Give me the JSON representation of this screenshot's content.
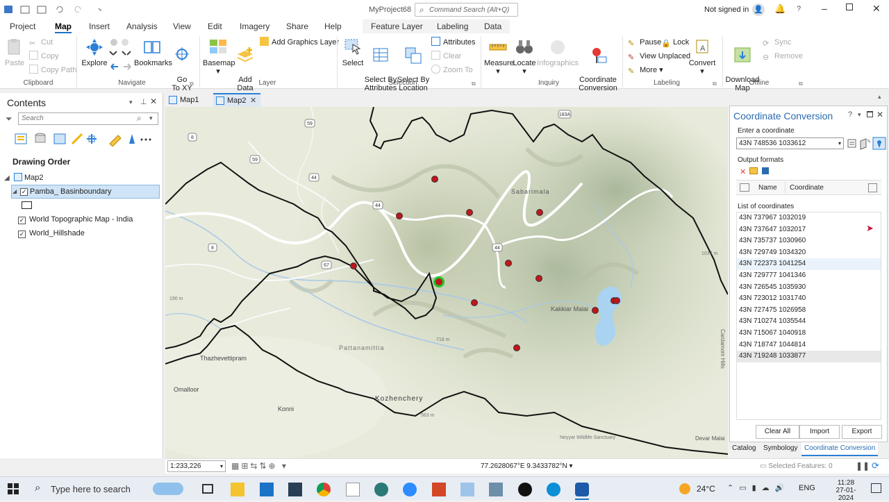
{
  "app": {
    "project_name": "MyProject68",
    "search_placeholder": "Command Search (Alt+Q)",
    "signin": "Not signed in"
  },
  "ribbon_tabs": [
    "Project",
    "Map",
    "Insert",
    "Analysis",
    "View",
    "Edit",
    "Imagery",
    "Share",
    "Help",
    "Feature Layer",
    "Labeling",
    "Data"
  ],
  "ribbon": {
    "clipboard": {
      "paste": "Paste",
      "cut": "Cut",
      "copy": "Copy",
      "copy_path": "Copy Path",
      "label": "Clipboard"
    },
    "navigate": {
      "explore": "Explore",
      "bookmarks": "Bookmarks",
      "go_to_xy": "Go\nTo XY",
      "label": "Navigate"
    },
    "layer": {
      "basemap": "Basemap",
      "add_data": "Add\nData",
      "add_graphics": "Add Graphics Layer",
      "label": "Layer"
    },
    "selection": {
      "select": "Select",
      "select_by_attributes": "Select By\nAttributes",
      "select_by_location": "Select By\nLocation",
      "attributes": "Attributes",
      "clear": "Clear",
      "zoom_to": "Zoom To",
      "label": "Selection"
    },
    "inquiry": {
      "measure": "Measure",
      "locate": "Locate",
      "infographics": "Infographics",
      "coordinate_conversion": "Coordinate\nConversion",
      "label": "Inquiry"
    },
    "labeling": {
      "pause": "Pause",
      "lock": "Lock",
      "view_unplaced": "View Unplaced",
      "more": "More",
      "convert": "Convert",
      "label": "Labeling"
    },
    "offline": {
      "download_map": "Download\nMap",
      "sync": "Sync",
      "remove": "Remove",
      "label": "Offline"
    }
  },
  "contents": {
    "title": "Contents",
    "search_placeholder": "Search",
    "drawing_order": "Drawing Order",
    "map_name": "Map2",
    "layers": [
      {
        "name": "Pamba_ Basinboundary",
        "checked": true,
        "selected": true
      },
      {
        "name": "World Topographic Map - India",
        "checked": true
      },
      {
        "name": "World_Hillshade",
        "checked": true
      }
    ]
  },
  "map_tabs": [
    {
      "name": "Map1"
    },
    {
      "name": "Map2",
      "active": true
    }
  ],
  "map": {
    "labels": [
      "Sabarimala",
      "Pattanamittia",
      "Thazhevettipram",
      "Omalloor",
      "Konni",
      "Kozhenchery",
      "Kakkiar Malai",
      "Devar Malai",
      "Neyyar Wildlife Sanctuary",
      "190 m",
      "718 m",
      "563 m",
      "1037 m",
      "Cardamom Hills"
    ],
    "road_shields": [
      "183A",
      "59",
      "8",
      "59",
      "44",
      "44",
      "44",
      "67",
      "8"
    ],
    "point_count": 13
  },
  "map_status": {
    "scale": "1:233,226",
    "coordinates": "77.2628067°E 9.3433782°N"
  },
  "coord_conversion": {
    "title": "Coordinate Conversion",
    "enter_label": "Enter a coordinate",
    "input_value": "43N 748536 1033612",
    "output_label": "Output formats",
    "col_name": "Name",
    "col_coordinate": "Coordinate",
    "list_label": "List of coordinates",
    "coordinates": [
      "43N 737967 1032019",
      "43N 737647 1032017",
      "43N 735737 1030960",
      "43N 729749 1034320",
      "43N 722373 1041254",
      "43N 729777 1041346",
      "43N 726545 1035930",
      "43N 723012 1031740",
      "43N 727475 1026958",
      "43N 710274 1035544",
      "43N 715067 1040918",
      "43N 718747 1044814",
      "43N 719248 1033877"
    ],
    "clear_all": "Clear All",
    "import": "Import",
    "export": "Export",
    "bottom_tabs": [
      "Catalog",
      "Symbology",
      "Coordinate Conversion"
    ],
    "selected_features": "Selected Features: 0"
  },
  "taskbar": {
    "search_placeholder": "Type here to search",
    "temperature": "24°C",
    "language": "ENG",
    "time": "11:28",
    "date": "27-01-2024"
  },
  "colors": {
    "accent": "#1a73c7",
    "point_fill": "#c0161b",
    "highlight_ring": "#22c42b",
    "boundary": "#111111"
  }
}
